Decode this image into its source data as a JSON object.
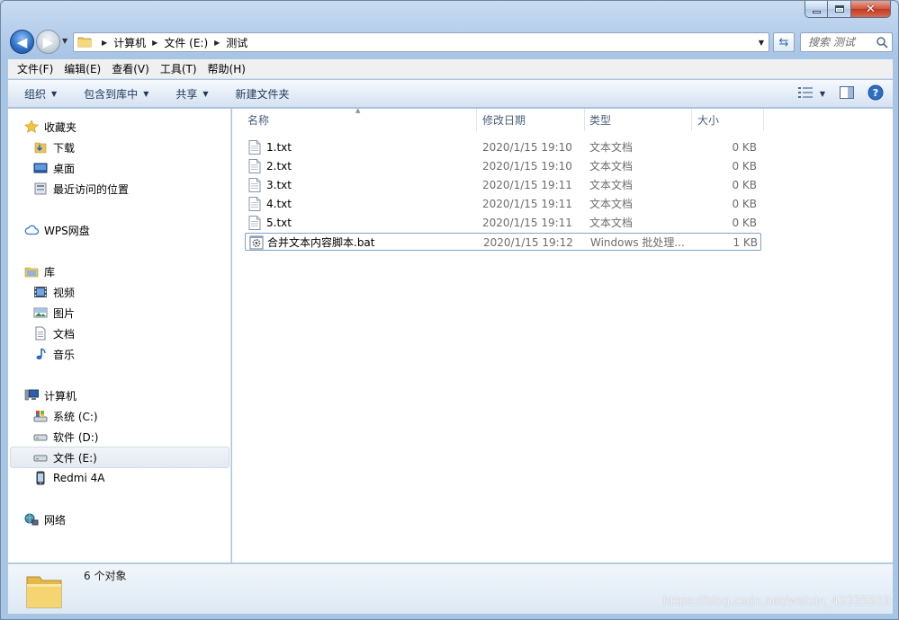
{
  "window": {
    "caption": {
      "close_glyph": "✕"
    }
  },
  "address": {
    "crumbs": [
      "计算机",
      "文件 (E:)",
      "测试"
    ],
    "search_placeholder": "搜索 测试"
  },
  "menubar": [
    "文件(F)",
    "编辑(E)",
    "查看(V)",
    "工具(T)",
    "帮助(H)"
  ],
  "commandbar": {
    "organize": "组织",
    "include_in_library": "包含到库中",
    "share": "共享",
    "new_folder": "新建文件夹"
  },
  "navpane": {
    "favorites": {
      "label": "收藏夹",
      "items": [
        "下载",
        "桌面",
        "最近访问的位置"
      ]
    },
    "wps": {
      "label": "WPS网盘"
    },
    "libraries": {
      "label": "库",
      "items": [
        "视频",
        "图片",
        "文档",
        "音乐"
      ]
    },
    "computer": {
      "label": "计算机",
      "items": [
        "系统 (C:)",
        "软件 (D:)",
        "文件 (E:)",
        "Redmi 4A"
      ]
    },
    "network": {
      "label": "网络"
    }
  },
  "columns": {
    "name": "名称",
    "modified": "修改日期",
    "type": "类型",
    "size": "大小"
  },
  "files": [
    {
      "name": "1.txt",
      "modified": "2020/1/15 19:10",
      "type": "文本文档",
      "size": "0 KB",
      "kind": "txt"
    },
    {
      "name": "2.txt",
      "modified": "2020/1/15 19:10",
      "type": "文本文档",
      "size": "0 KB",
      "kind": "txt"
    },
    {
      "name": "3.txt",
      "modified": "2020/1/15 19:11",
      "type": "文本文档",
      "size": "0 KB",
      "kind": "txt"
    },
    {
      "name": "4.txt",
      "modified": "2020/1/15 19:11",
      "type": "文本文档",
      "size": "0 KB",
      "kind": "txt"
    },
    {
      "name": "5.txt",
      "modified": "2020/1/15 19:11",
      "type": "文本文档",
      "size": "0 KB",
      "kind": "txt"
    },
    {
      "name": "合并文本内容脚本.bat",
      "modified": "2020/1/15 19:12",
      "type": "Windows 批处理...",
      "size": "1 KB",
      "kind": "bat"
    }
  ],
  "status": {
    "count": "6 个对象"
  },
  "watermark": "https://blog.csdn.net/weixin_43335519"
}
